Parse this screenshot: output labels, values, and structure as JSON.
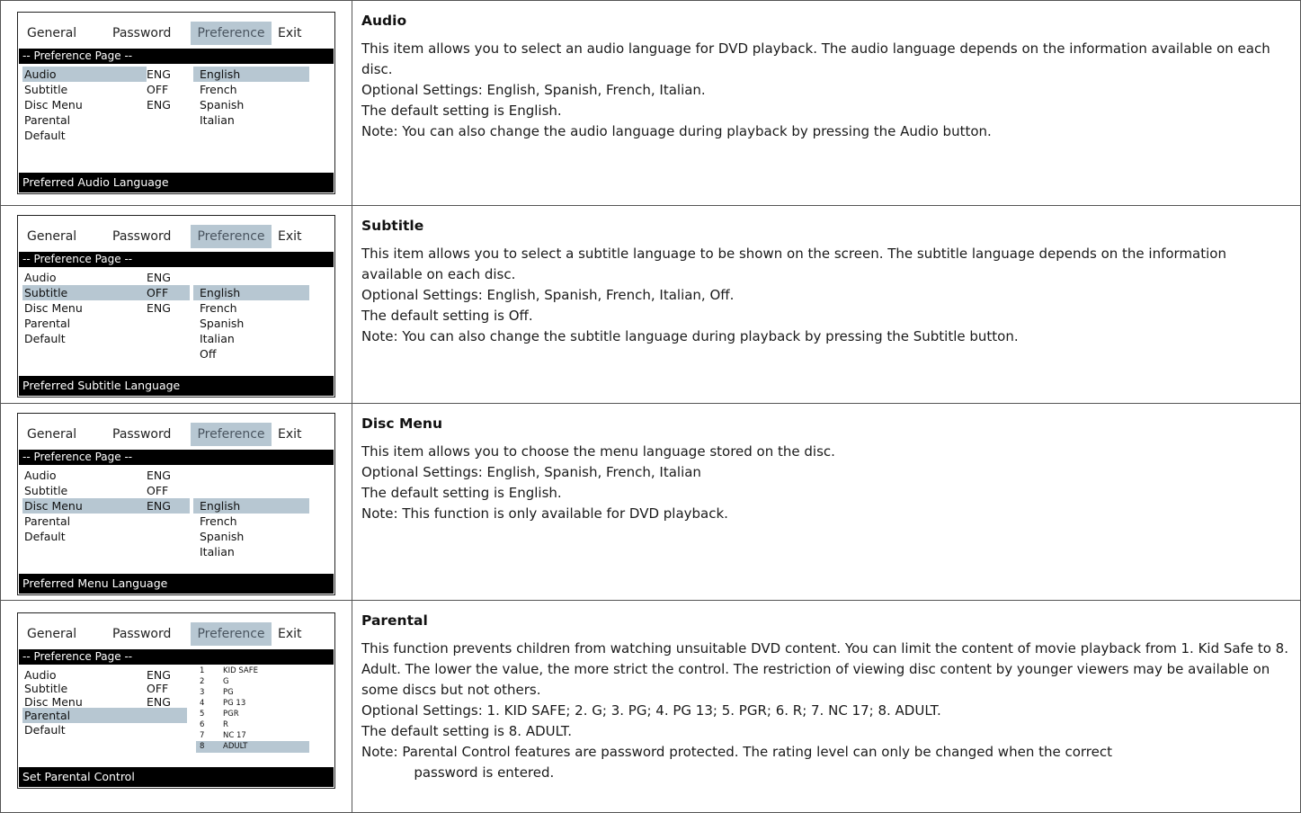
{
  "osd_common": {
    "tabs": [
      "General",
      "Password",
      "Preference",
      "Exit"
    ],
    "page_label": "-- Preference Page --"
  },
  "rows": [
    {
      "osd": {
        "items": [
          {
            "label": "Audio",
            "value": "ENG"
          },
          {
            "label": "Subtitle",
            "value": "OFF"
          },
          {
            "label": "Disc Menu",
            "value": "ENG"
          },
          {
            "label": "Parental",
            "value": ""
          },
          {
            "label": "Default",
            "value": ""
          }
        ],
        "options": [
          "English",
          "French",
          "Spanish",
          "Italian"
        ],
        "footer": "Preferred Audio Language"
      },
      "title": "Audio",
      "lines": [
        "This item allows you to select an audio language for DVD playback. The audio language depends on the information available on each disc.",
        "Optional Settings: English, Spanish, French, Italian.",
        "The default setting is English.",
        "Note: You can also change the audio language during playback by pressing the Audio button."
      ]
    },
    {
      "osd": {
        "items": [
          {
            "label": "Audio",
            "value": "ENG"
          },
          {
            "label": "Subtitle",
            "value": "OFF"
          },
          {
            "label": "Disc Menu",
            "value": "ENG"
          },
          {
            "label": "Parental",
            "value": ""
          },
          {
            "label": "Default",
            "value": ""
          }
        ],
        "options": [
          "English",
          "French",
          "Spanish",
          "Italian",
          "Off"
        ],
        "footer": "Preferred Subtitle Language"
      },
      "title": "Subtitle",
      "lines": [
        "This item allows you to select a subtitle language to be shown on the screen. The subtitle language depends on the information available on each disc.",
        "Optional Settings: English, Spanish, French, Italian, Off.",
        "The default setting is Off.",
        "Note: You can also change the subtitle language during playback by pressing the Subtitle button."
      ]
    },
    {
      "osd": {
        "items": [
          {
            "label": "Audio",
            "value": "ENG"
          },
          {
            "label": "Subtitle",
            "value": "OFF"
          },
          {
            "label": "Disc Menu",
            "value": "ENG"
          },
          {
            "label": "Parental",
            "value": ""
          },
          {
            "label": "Default",
            "value": ""
          }
        ],
        "options": [
          "English",
          "French",
          "Spanish",
          "Italian"
        ],
        "footer": "Preferred Menu Language"
      },
      "title": "Disc Menu",
      "lines": [
        "This item allows you to choose the menu language stored on the disc.",
        "Optional Settings: English, Spanish, French, Italian",
        "The default setting is English.",
        "Note: This function is only available for DVD playback."
      ]
    },
    {
      "osd": {
        "items": [
          {
            "label": "Audio",
            "value": "ENG"
          },
          {
            "label": "Subtitle",
            "value": "OFF"
          },
          {
            "label": "Disc Menu",
            "value": "ENG"
          },
          {
            "label": "Parental",
            "value": ""
          },
          {
            "label": "Default",
            "value": ""
          }
        ],
        "ratings": [
          {
            "num": "1",
            "text": "KID SAFE"
          },
          {
            "num": "2",
            "text": "G"
          },
          {
            "num": "3",
            "text": "PG"
          },
          {
            "num": "4",
            "text": "PG 13"
          },
          {
            "num": "5",
            "text": "PGR"
          },
          {
            "num": "6",
            "text": "R"
          },
          {
            "num": "7",
            "text": "NC 17"
          },
          {
            "num": "8",
            "text": "ADULT"
          }
        ],
        "footer": "Set Parental Control"
      },
      "title": "Parental",
      "lines": [
        "This function prevents children from watching unsuitable DVD content. You can limit the content of movie playback from 1. Kid Safe to 8. Adult. The lower the value, the more strict the control. The restriction of viewing disc content by younger viewers may be available on some discs but not others.",
        "Optional Settings: 1.  KID SAFE;  2.  G;  3.  PG;  4.  PG 13;  5.  PGR;  6.  R;  7.  NC 17;  8.  ADULT.",
        "The default setting is 8.  ADULT."
      ],
      "note_prefix": "Note: ",
      "note_line1": "Parental Control features are password protected. The rating level can only be changed when the correct",
      "note_line2": "password is entered."
    }
  ]
}
